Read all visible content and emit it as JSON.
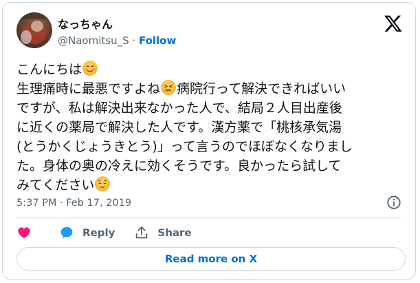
{
  "author": {
    "name": "なっちゃん",
    "handle": "@Naomitsu_S",
    "separator": "·",
    "follow_label": "Follow"
  },
  "tweet": {
    "line1": "こんにちは",
    "line2a": "生理痛時に最悪ですよね",
    "line2b": "病院行って解決できればいい",
    "line3": "ですが、私は解決出来なかった人で、結局２人目出産後",
    "line4": "に近くの薬局で解決した人です。漢方薬で「桃核承気湯",
    "line5": "(とうかくじょうきとう)」って言うのでほぼなくなりまし",
    "line6": "た。身体の奥の冷えに効くそうです。良かったら試して",
    "line7": "みてください",
    "emojis": [
      "smiling-face-with-blush",
      "confounded-face",
      "relieved-face"
    ]
  },
  "meta": {
    "timestamp": "5:37 PM · Feb 17, 2019"
  },
  "actions": {
    "like_label": "",
    "reply_label": "Reply",
    "share_label": "Share"
  },
  "footer": {
    "read_more_label": "Read more on X"
  },
  "colors": {
    "like": "#f91880",
    "reply": "#1d9bf0",
    "link": "#006fd6",
    "secondary_text": "#536471",
    "border": "#cfd9de"
  }
}
